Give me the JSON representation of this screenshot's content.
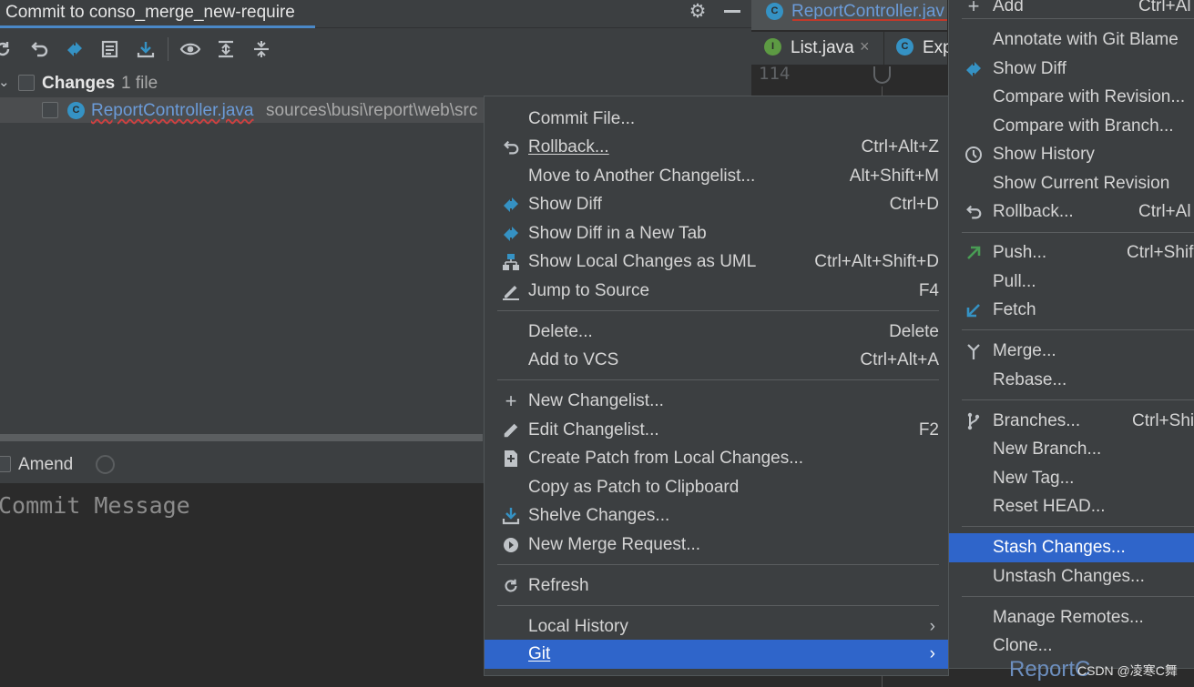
{
  "commit_panel": {
    "title": "Commit to conso_merge_new-require",
    "changes_label": "Changes",
    "changes_count": "1 file",
    "file_name": "ReportController.java",
    "file_path": "sources\\busi\\report\\web\\src",
    "amend_label": "Amend",
    "commit_message_placeholder": "Commit Message"
  },
  "editor": {
    "tab_active": "ReportController.jav",
    "tab_list": "List.java",
    "tab_exp": "Exp",
    "line_number": "114",
    "bottom_text": "ReportC"
  },
  "context_menu": {
    "items": [
      {
        "label": "Commit File...",
        "shortcut": "",
        "icon": ""
      },
      {
        "label": "Rollback...",
        "shortcut": "Ctrl+Alt+Z",
        "icon": "rollback-icon"
      },
      {
        "label": "Move to Another Changelist...",
        "shortcut": "Alt+Shift+M",
        "icon": ""
      },
      {
        "label": "Show Diff",
        "shortcut": "Ctrl+D",
        "icon": "diff-icon"
      },
      {
        "label": "Show Diff in a New Tab",
        "shortcut": "",
        "icon": "diff-icon"
      },
      {
        "label": "Show Local Changes as UML",
        "shortcut": "Ctrl+Alt+Shift+D",
        "icon": "uml-icon"
      },
      {
        "label": "Jump to Source",
        "shortcut": "F4",
        "icon": "edit-pencil-icon"
      },
      {
        "label": "Delete...",
        "shortcut": "Delete",
        "icon": ""
      },
      {
        "label": "Add to VCS",
        "shortcut": "Ctrl+Alt+A",
        "icon": ""
      },
      {
        "label": "New Changelist...",
        "shortcut": "",
        "icon": "plus-icon"
      },
      {
        "label": "Edit Changelist...",
        "shortcut": "F2",
        "icon": "pencil-icon"
      },
      {
        "label": "Create Patch from Local Changes...",
        "shortcut": "",
        "icon": "patch-icon"
      },
      {
        "label": "Copy as Patch to Clipboard",
        "shortcut": "",
        "icon": ""
      },
      {
        "label": "Shelve Changes...",
        "shortcut": "",
        "icon": "shelve-icon"
      },
      {
        "label": "New Merge Request...",
        "shortcut": "",
        "icon": "merge-request-icon"
      },
      {
        "label": "Refresh",
        "shortcut": "",
        "icon": "refresh-icon"
      },
      {
        "label": "Local History",
        "shortcut": "",
        "icon": ""
      },
      {
        "label": "Git",
        "shortcut": "",
        "icon": ""
      }
    ]
  },
  "git_menu": {
    "items": [
      {
        "label": "Add",
        "shortcut": "Ctrl+Al"
      },
      {
        "label": "Annotate with Git Blame",
        "shortcut": ""
      },
      {
        "label": "Show Diff",
        "shortcut": ""
      },
      {
        "label": "Compare with Revision...",
        "shortcut": ""
      },
      {
        "label": "Compare with Branch...",
        "shortcut": ""
      },
      {
        "label": "Show History",
        "shortcut": ""
      },
      {
        "label": "Show Current Revision",
        "shortcut": ""
      },
      {
        "label": "Rollback...",
        "shortcut": "Ctrl+Al"
      },
      {
        "label": "Push...",
        "shortcut": "Ctrl+Shif"
      },
      {
        "label": "Pull...",
        "shortcut": ""
      },
      {
        "label": "Fetch",
        "shortcut": ""
      },
      {
        "label": "Merge...",
        "shortcut": ""
      },
      {
        "label": "Rebase...",
        "shortcut": ""
      },
      {
        "label": "Branches...",
        "shortcut": "Ctrl+Shi"
      },
      {
        "label": "New Branch...",
        "shortcut": ""
      },
      {
        "label": "New Tag...",
        "shortcut": ""
      },
      {
        "label": "Reset HEAD...",
        "shortcut": ""
      },
      {
        "label": "Stash Changes...",
        "shortcut": ""
      },
      {
        "label": "Unstash Changes...",
        "shortcut": ""
      },
      {
        "label": "Manage Remotes...",
        "shortcut": ""
      },
      {
        "label": "Clone...",
        "shortcut": ""
      }
    ]
  },
  "watermark": "CSDN @凌寒C舞",
  "colors": {
    "selection": "#2f65ca",
    "panel": "#3c3f41",
    "editor_bg": "#2b2b2b",
    "diff_blue": "#3592c4",
    "push_green": "#499c54"
  }
}
